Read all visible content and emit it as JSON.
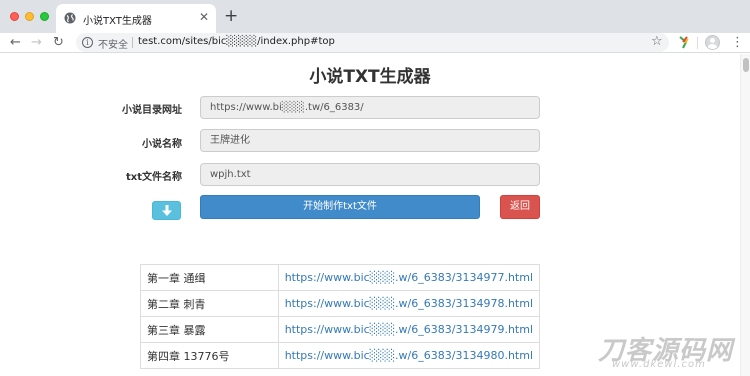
{
  "browser": {
    "tab_title": "小说TXT生成器",
    "new_tab_label": "+",
    "security_label": "不安全",
    "url": "test.com/sites/bic░░░░/index.php#top"
  },
  "page": {
    "title": "小说TXT生成器",
    "form": {
      "url_label": "小说目录网址",
      "url_value": "https://www.bi░░░.tw/6_6383/",
      "name_label": "小说名称",
      "name_value": "王牌进化",
      "file_label": "txt文件名称",
      "file_value": "wpjh.txt"
    },
    "buttons": {
      "start_label": "开始制作txt文件",
      "back_label": "返回"
    },
    "chapters": [
      {
        "title": "第一章 通缉",
        "url": "https://www.bic░░░.w/6_6383/3134977.html"
      },
      {
        "title": "第二章 刺青",
        "url": "https://www.bic░░░.w/6_6383/3134978.html"
      },
      {
        "title": "第三章 暴露",
        "url": "https://www.bic░░░.w/6_6383/3134979.html"
      },
      {
        "title": "第四章 13776号",
        "url": "https://www.bic░░░.w/6_6383/3134980.html"
      }
    ]
  },
  "watermark": {
    "text": "刀客源码网",
    "url": "www.dkewl.com"
  }
}
